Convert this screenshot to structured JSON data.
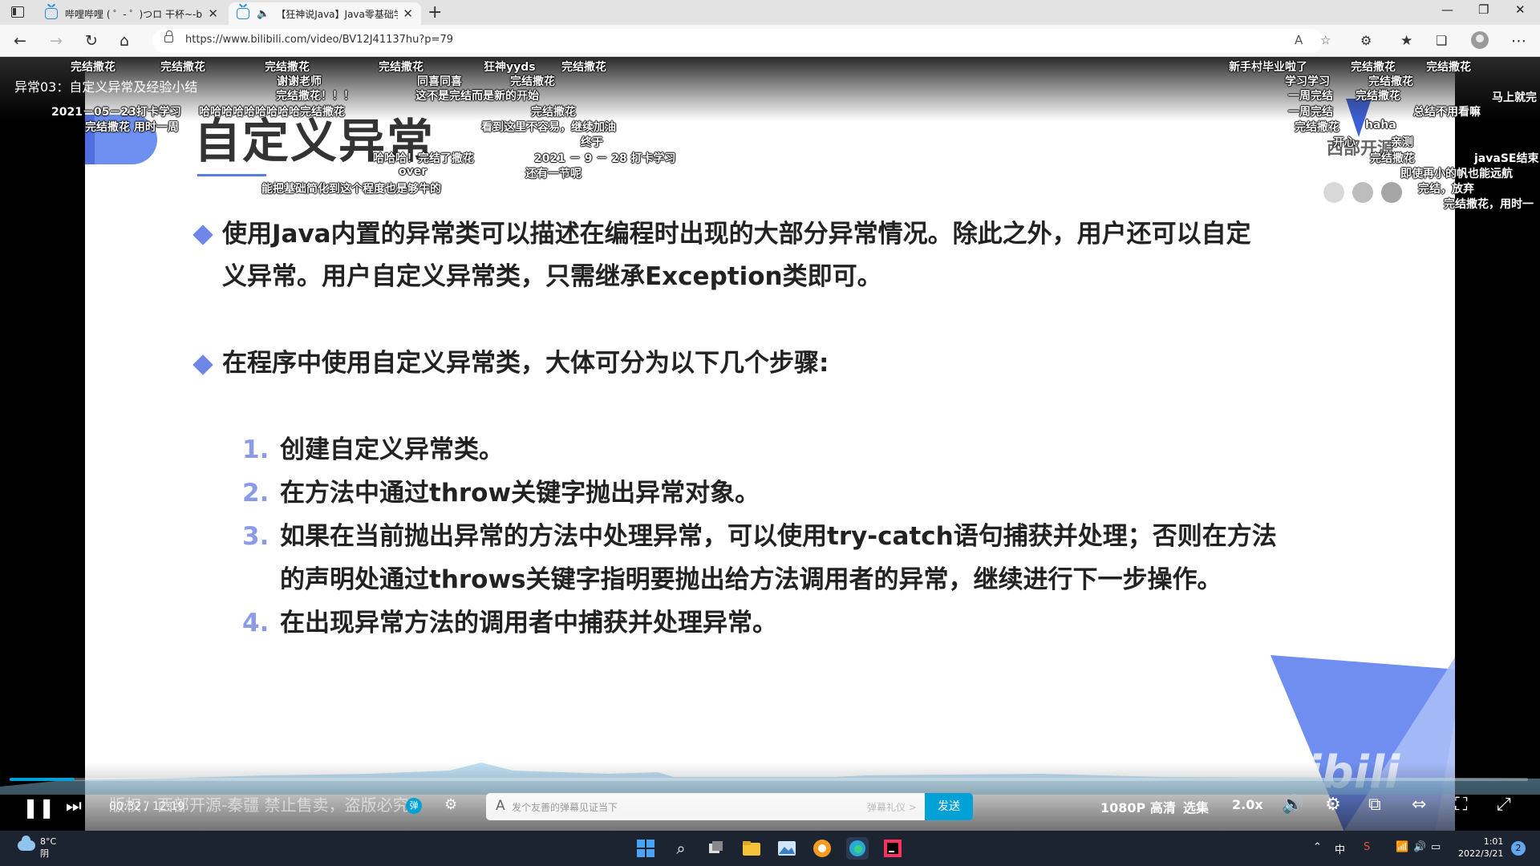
{
  "browser": {
    "tabs": [
      {
        "title": "哔哩哔哩 ( ゜- ゜)つロ 干杯~-bilibili",
        "active": false
      },
      {
        "title": "【狂神说Java】Java零基础学习视频",
        "active": true
      }
    ],
    "url": "https://www.bilibili.com/video/BV12J41137hu?p=79"
  },
  "video": {
    "title": "异常03：自定义异常及经验小结"
  },
  "slide": {
    "heading": "自定义异常",
    "bullets": [
      {
        "line1": "使用Java内置的异常类可以描述在编程时出现的大部分异常情况。除此之外，用户还可以自定",
        "line2": "义异常。用户自定义异常类，只需继承Exception类即可。"
      },
      {
        "line1": "在程序中使用自定义异常类，大体可分为以下几个步骤:"
      }
    ],
    "steps": [
      {
        "num": "1.",
        "text": "创建自定义异常类。"
      },
      {
        "num": "2.",
        "text": "在方法中通过throw关键字抛出异常对象。"
      },
      {
        "num": "3.",
        "text": "如果在当前抛出异常的方法中处理异常，可以使用try-catch语句捕获并处理；否则在方法",
        "text2": "的声明处通过throws关键字指明要抛出给方法调用者的异常，继续进行下一步操作。"
      },
      {
        "num": "4.",
        "text": "在出现异常方法的调用者中捕获并处理异常。"
      }
    ],
    "brand": "西部开源",
    "dot_colors": [
      "#d8d8d8",
      "#bdbdbd",
      "#a5a5a5"
    ],
    "accent": "#6e86e6"
  },
  "danmaku": [
    "完结撒花",
    "完结撒花",
    "完结撒花",
    "完结撒花",
    "狂神yyds",
    "完结撒花",
    "谢谢老师",
    "同喜同喜",
    "完结撒花",
    "完结撒花！！！",
    "这不是完结而是新的开始",
    "2021－05－23打卡学习",
    "哈哈哈哈哈哈哈哈哈完结撒花",
    "完结撒花",
    "完结撒花  用时一周",
    "看到这里不容易，继续加油",
    "终于",
    "哈哈哈！完结了撒花",
    "2021 － 9 － 28 打卡学习",
    "over",
    "还有一节呢",
    "能把基础简化到这个程度也是够牛的",
    "新手村毕业啦了",
    "学习学习",
    "完结撒花",
    "完结撒花",
    "一周完结",
    "完结撒花",
    "完结撒花",
    "完结撒花",
    "haha",
    "开心",
    "总结不用看嘛",
    "亲测",
    "完结撒花",
    "javaSE结束",
    "即使再小的帆也能远航",
    "完结，放弃",
    "完结撒花，用时一",
    "马上就完",
    "一周完结"
  ],
  "player": {
    "current_time": "00:32",
    "total_time": "12:19",
    "progress": 0.043,
    "watermark": "版权：西部开源-秦疆    禁止售卖，盗版必究",
    "danmaku_placeholder": "发个友善的弹幕见证当下",
    "danmaku_etiquette": "弹幕礼仪 >",
    "send_label": "发送",
    "quality": "1080P 高清",
    "episodes": "选集",
    "speed": "2.0x",
    "danmaku_toggle_label": "弹"
  },
  "taskbar": {
    "temperature": "8°C",
    "weather": "阴",
    "ime": "中",
    "time": "1:01",
    "date": "2022/3/21",
    "notifications": "2"
  }
}
